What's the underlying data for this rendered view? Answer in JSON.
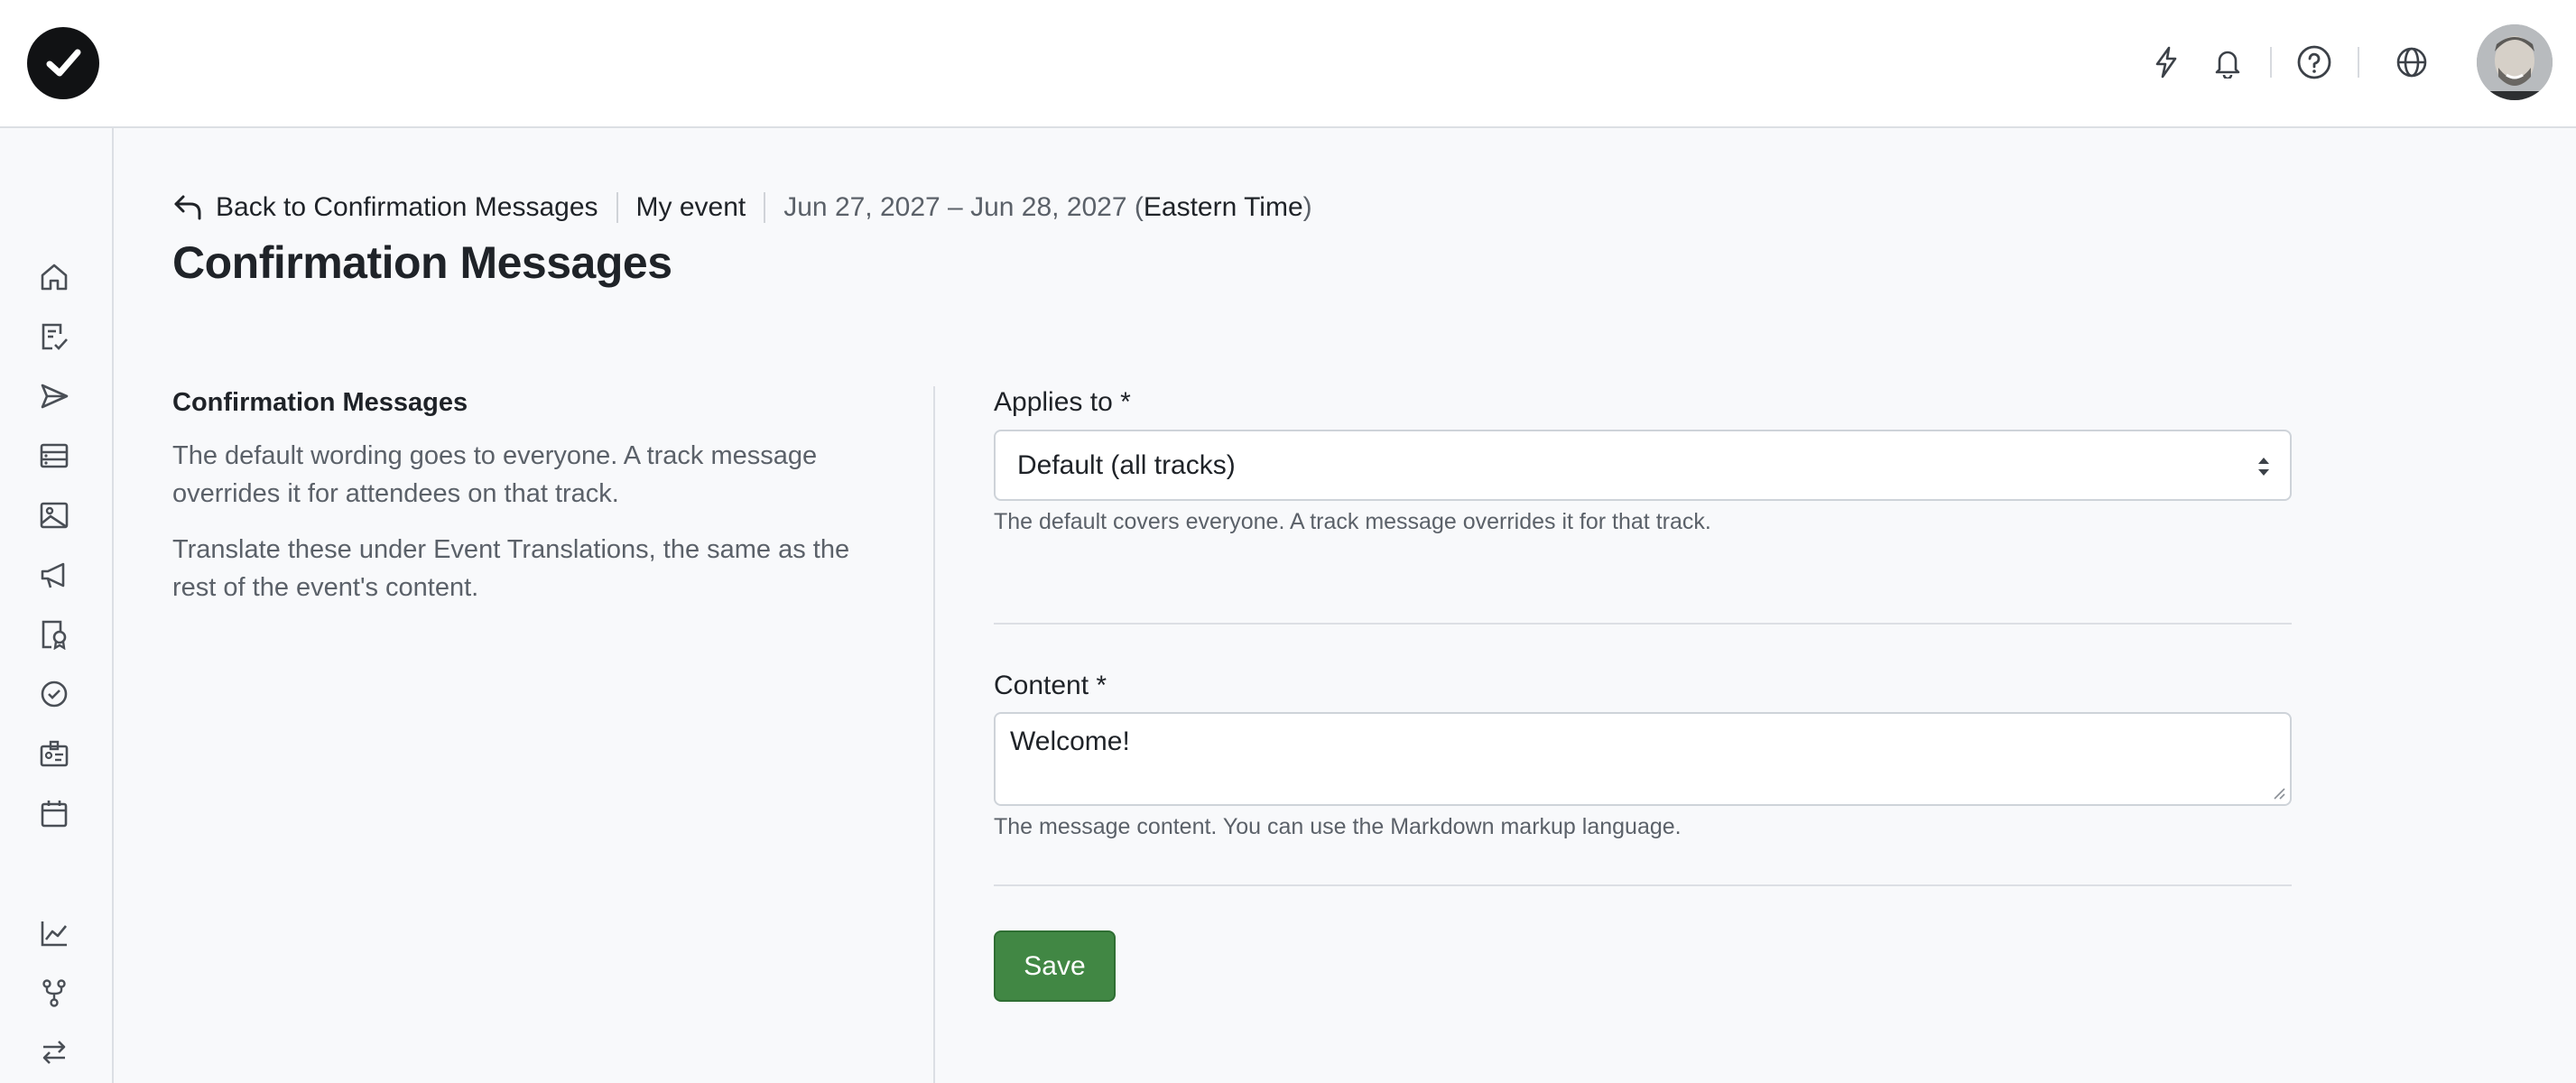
{
  "topbar": {
    "icons": [
      "logo-check-icon",
      "lightning-icon",
      "bell-icon",
      "help-circle-icon",
      "globe-icon"
    ],
    "avatar_alt": ""
  },
  "sidebar": {
    "icons": [
      "home-icon",
      "form-check-icon",
      "send-icon",
      "list-icon",
      "image-icon",
      "megaphone-icon",
      "badge-icon",
      "check-badge-icon",
      "id-card-icon",
      "calendar-icon",
      "chart-icon",
      "branch-icon",
      "swap-icon"
    ]
  },
  "breadcrumb": {
    "back_label": "Back to Confirmation Messages",
    "event_name": "My event",
    "date_range": "Jun 27, 2027 – Jun 28, 2027 (",
    "timezone": "Eastern Time",
    "close_paren": ")"
  },
  "page": {
    "title": "Confirmation Messages"
  },
  "description": {
    "title": "Confirmation Messages",
    "paragraph1": "The default wording goes to everyone. A track message overrides it for attendees on that track.",
    "paragraph2": "Translate these under Event Translations, the same as the rest of the event's content."
  },
  "form": {
    "applies_to_label": "Applies to *",
    "applies_to_value": "Default (all tracks)",
    "applies_to_help": "The default covers everyone. A track message overrides it for that track.",
    "content_label": "Content *",
    "content_value": "Welcome!",
    "content_help": "The message content. You can use the Markdown markup language.",
    "save_label": "Save"
  },
  "colors": {
    "accent_green": "#418744",
    "background": "#f8f9fb",
    "text_primary": "#1f2328",
    "text_muted": "#5b6169"
  }
}
